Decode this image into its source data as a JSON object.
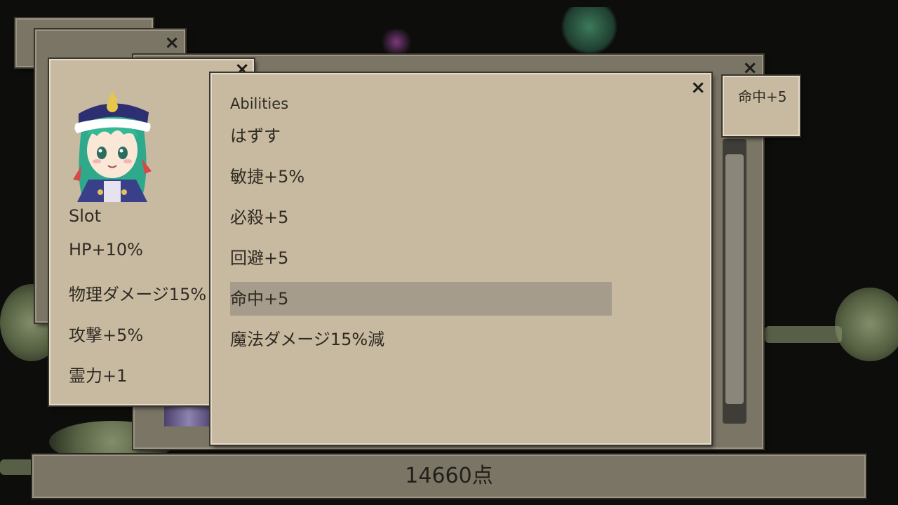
{
  "slot_panel": {
    "heading": "Slot",
    "stats": [
      "HP+10%",
      "物理ダメージ15%",
      "攻撃+5%",
      "霊力+1"
    ]
  },
  "abilities_panel": {
    "heading": "Abilities",
    "items": [
      "はずす",
      "敏捷+5%",
      "必殺+5",
      "回避+5",
      "命中+5",
      "魔法ダメージ15%減"
    ],
    "selected_index": 4
  },
  "tooltip": {
    "text": "命中+5"
  },
  "score": {
    "text": "14660点"
  },
  "icons": {
    "close": "×"
  },
  "colors": {
    "panel": "#c8baa0",
    "selected_row": "#a59c8c",
    "frame": "#7b7566"
  }
}
